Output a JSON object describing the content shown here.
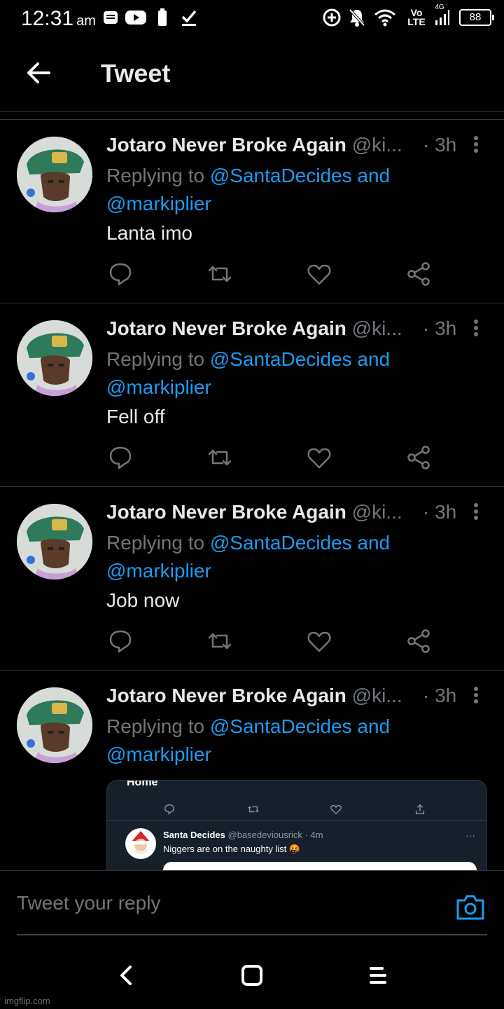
{
  "status_bar": {
    "time": "12:31",
    "ampm": "am",
    "network_small": "4G",
    "volte_top": "Vo",
    "volte_bottom": "LTE",
    "battery": "88"
  },
  "header": {
    "title": "Tweet"
  },
  "tweets": [
    {
      "name": "Jotaro Never Broke Again",
      "handle": "@ki...",
      "time": "· 3h",
      "replying_prefix": "Replying to",
      "mention1": "@SantaDecides and",
      "mention2": "@markiplier",
      "text": "Lanta imo"
    },
    {
      "name": "Jotaro Never Broke Again",
      "handle": "@ki...",
      "time": "· 3h",
      "replying_prefix": "Replying to",
      "mention1": "@SantaDecides and",
      "mention2": "@markiplier",
      "text": "Fell off"
    },
    {
      "name": "Jotaro Never Broke Again",
      "handle": "@ki...",
      "time": "· 3h",
      "replying_prefix": "Replying to",
      "mention1": "@SantaDecides and",
      "mention2": "@markiplier",
      "text": "Job now"
    },
    {
      "name": "Jotaro Never Broke Again",
      "handle": "@ki...",
      "time": "· 3h",
      "replying_prefix": "Replying to",
      "mention1": "@SantaDecides and",
      "mention2": "@markiplier",
      "text": ""
    }
  ],
  "embedded": {
    "header_partial": "Home",
    "name": "Santa Decides",
    "handle_time": "@basedeviousrick · 4m",
    "text": "Niggers are on the naughty list 🤬",
    "more": "···"
  },
  "reply_bar": {
    "placeholder": "Tweet your reply"
  },
  "watermark": "imgflip.com",
  "colors": {
    "background": "#000000",
    "link": "#1d9bf0",
    "secondary_text": "#71767b",
    "divider": "#2f3336"
  }
}
